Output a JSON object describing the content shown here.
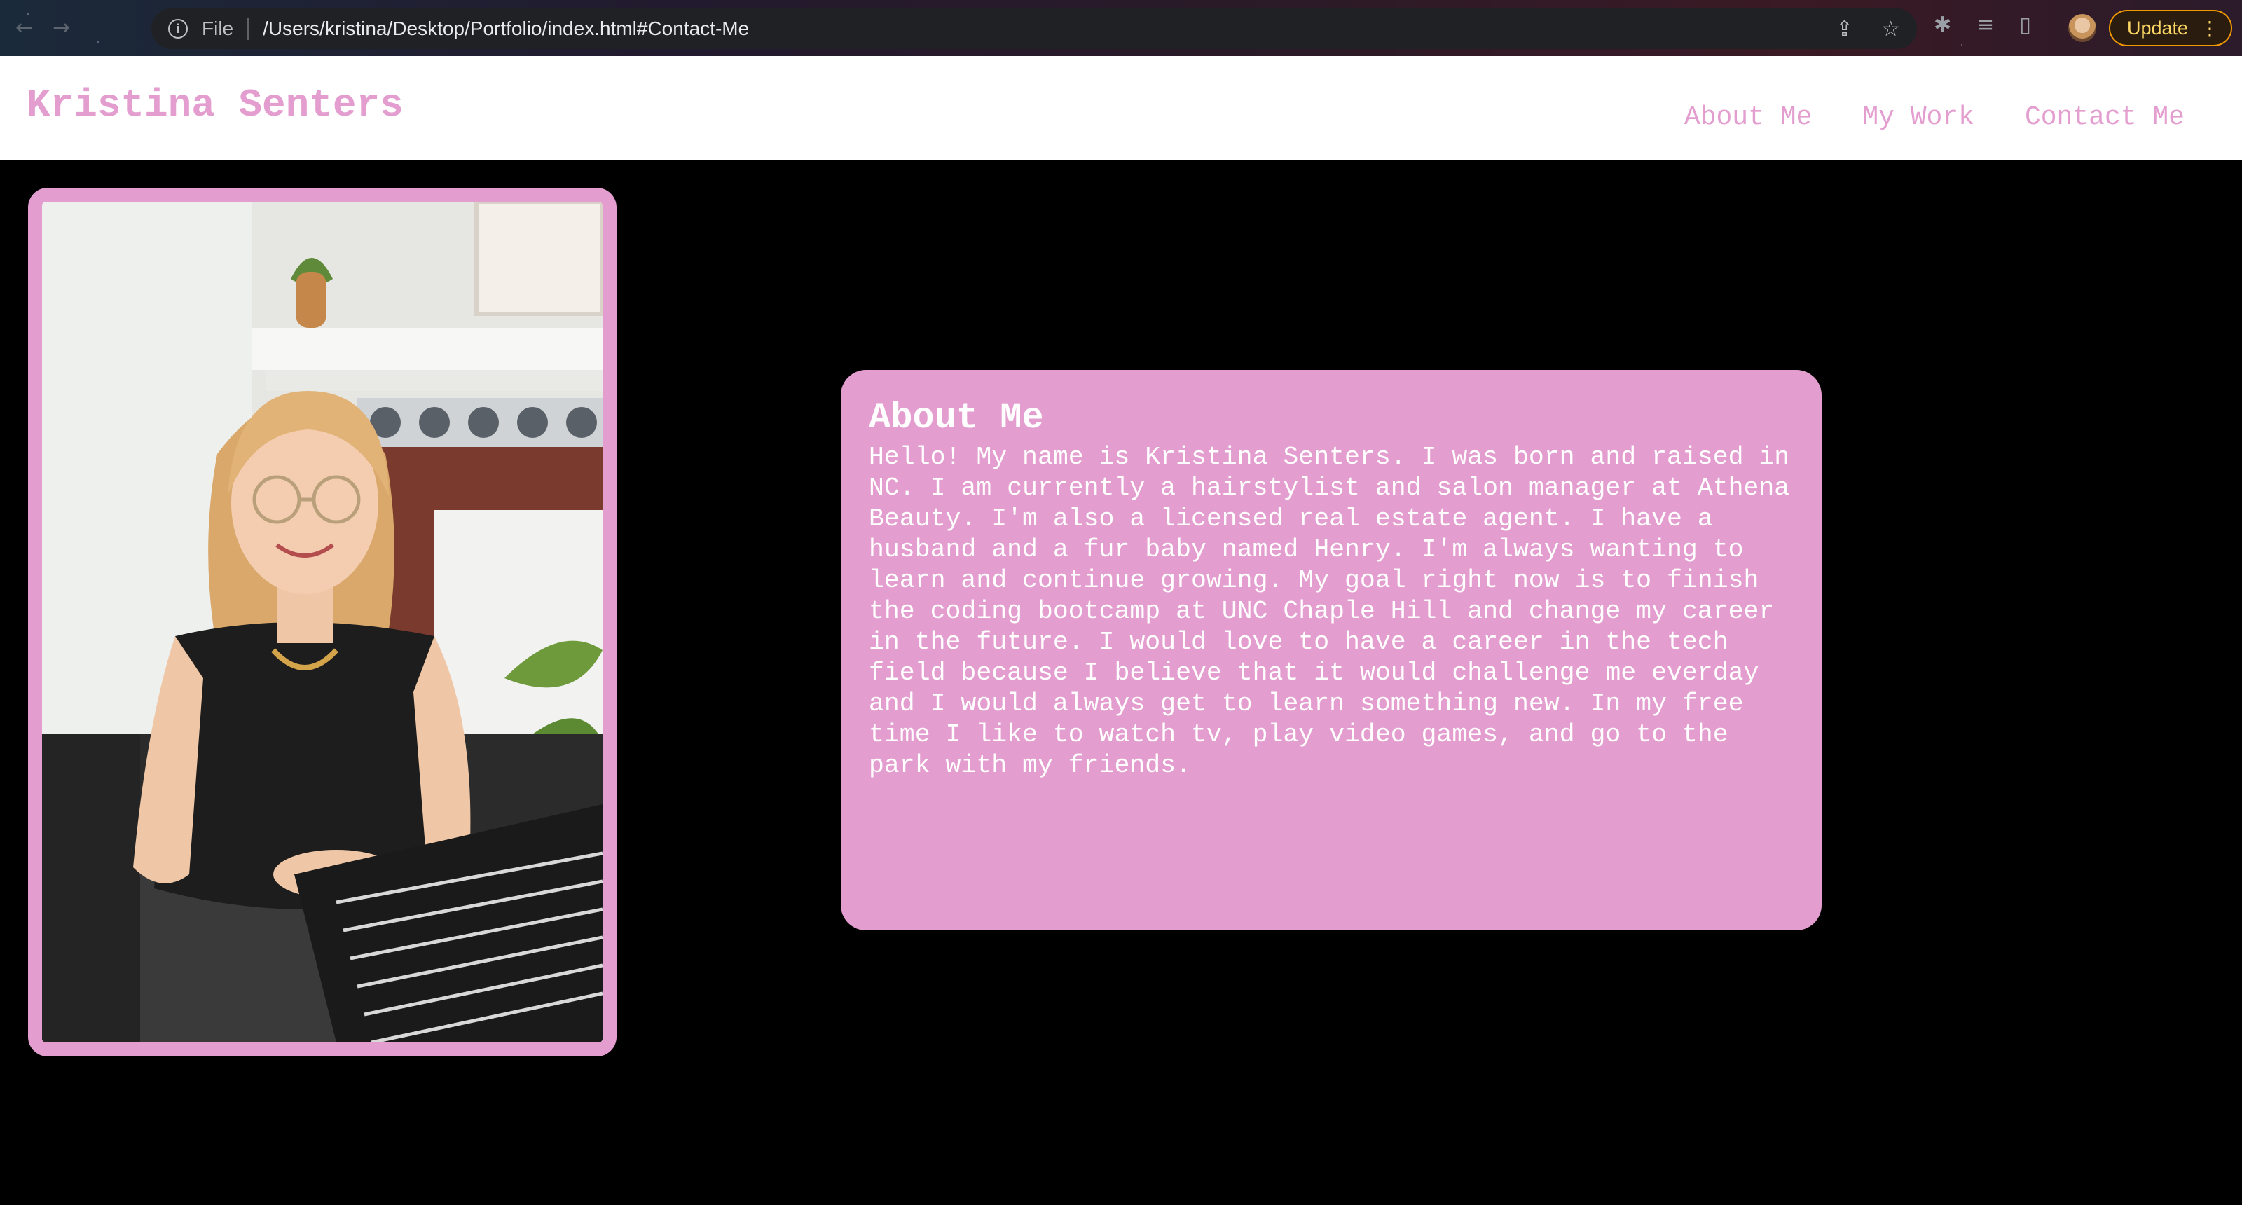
{
  "browser": {
    "scheme_label": "File",
    "url": "/Users/kristina/Desktop/Portfolio/index.html#Contact-Me",
    "update_label": "Update"
  },
  "site": {
    "title": "Kristina Senters",
    "nav": [
      {
        "label": "About Me"
      },
      {
        "label": "My Work"
      },
      {
        "label": "Contact Me"
      }
    ]
  },
  "about": {
    "heading": "About Me",
    "body": "Hello! My name is Kristina Senters. I was born and raised in NC. I am currently a hairstylist and salon manager at Athena Beauty. I'm also a licensed real estate agent. I have a husband and a fur baby named Henry. I'm always wanting to learn and continue growing. My goal right now is to finish the coding bootcamp at UNC Chaple Hill and change my career in the future. I would love to have a career in the tech field because I believe that it would challenge me everday and I would always get to learn something new. In my free time I like to watch tv, play video games, and go to the park with my friends."
  },
  "colors": {
    "accent_pink": "#e39ecf",
    "page_background": "#000000",
    "header_background": "#ffffff"
  }
}
